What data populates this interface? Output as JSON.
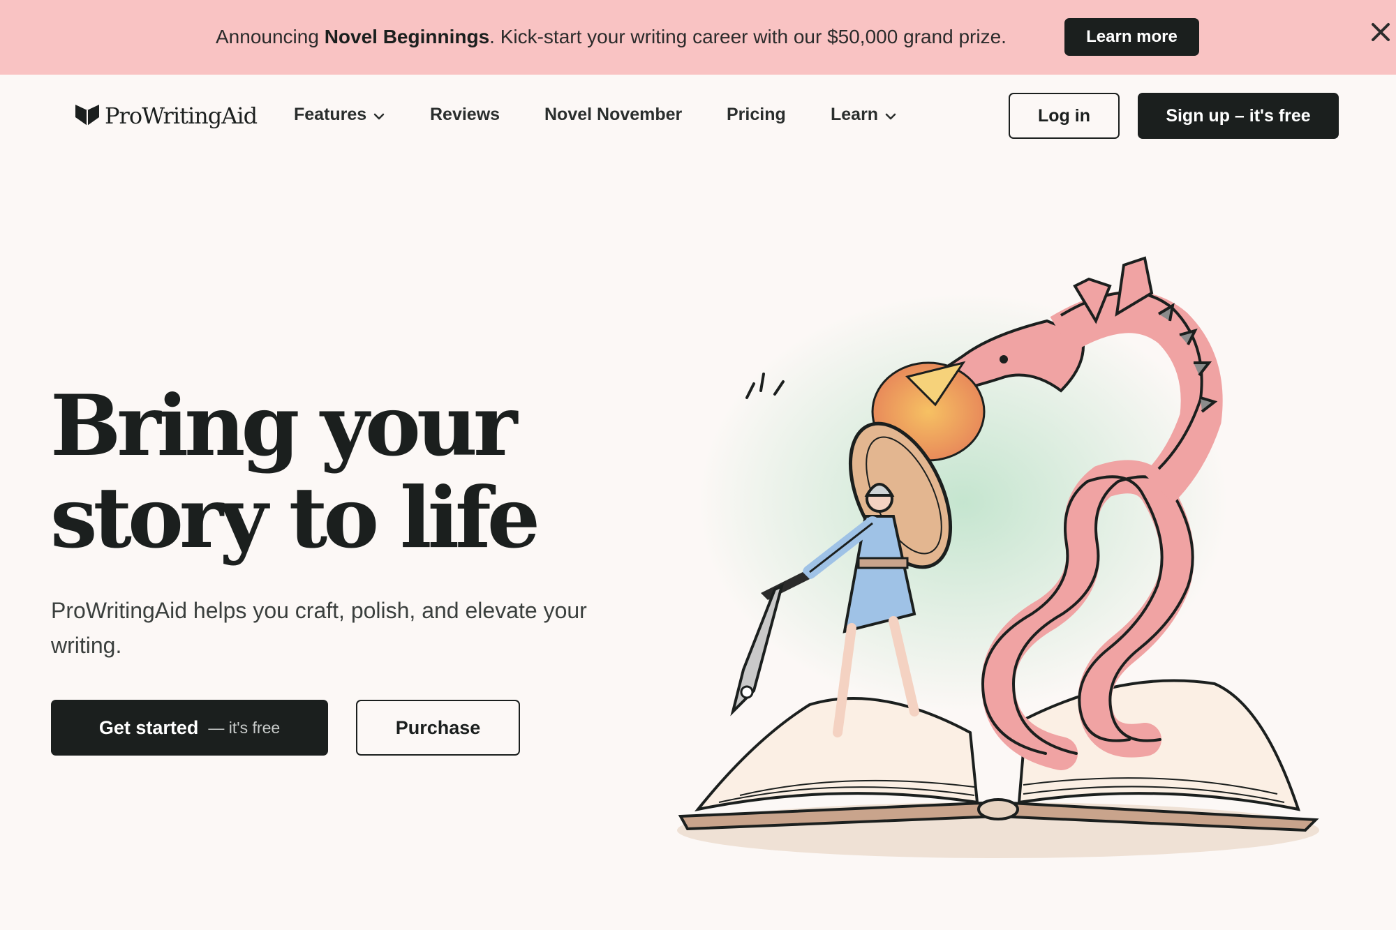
{
  "banner": {
    "prefix": "Announcing ",
    "highlight": "Novel Beginnings",
    "suffix": ". Kick-start your writing career with our $50,000 grand prize.",
    "button_label": "Learn more",
    "close_icon": "close-icon"
  },
  "nav": {
    "logo_text": "ProWritingAid",
    "logo_icon": "book-heart-icon",
    "items": [
      {
        "label": "Features",
        "has_dropdown": true
      },
      {
        "label": "Reviews",
        "has_dropdown": false
      },
      {
        "label": "Novel November",
        "has_dropdown": false
      },
      {
        "label": "Pricing",
        "has_dropdown": false
      },
      {
        "label": "Learn",
        "has_dropdown": true
      }
    ],
    "login_label": "Log in",
    "signup_label": "Sign up – it's free"
  },
  "hero": {
    "title_line1": "Bring your",
    "title_line2": "story to life",
    "subtitle": "ProWritingAid helps you craft, polish, and elevate your writing.",
    "cta_main": "Get started",
    "cta_sub": "— it's free",
    "purchase_label": "Purchase",
    "illustration": "dragon-knight-book-illustration"
  },
  "colors": {
    "banner_bg": "#f9c3c3",
    "page_bg": "#fcf8f6",
    "primary": "#1b1f1e",
    "dragon": "#f0a3a3",
    "knight": "#9fc2e6"
  }
}
